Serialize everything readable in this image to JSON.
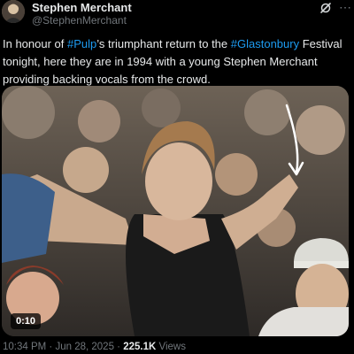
{
  "header": {
    "display_name": "Stephen Merchant",
    "handle": "@StephenMerchant",
    "icons": [
      "grok-icon",
      "more-icon"
    ]
  },
  "tweet": {
    "text_parts": {
      "p1": "In honour of ",
      "tag1": "#Pulp",
      "p2": "’s triumphant return to the ",
      "tag2": "#Glastonbury",
      "p3": " Festival tonight, here they are in 1994 with a young Stephen Merchant providing backing vocals from the crowd."
    },
    "hashtag_color": "#1d9bf0"
  },
  "video": {
    "duration": "0:10"
  },
  "meta": {
    "time": "10:34 PM",
    "sep1": " · ",
    "date": "Jun 28, 2025",
    "sep2": " · ",
    "views_count": "225.1K",
    "views_label": " Views"
  }
}
